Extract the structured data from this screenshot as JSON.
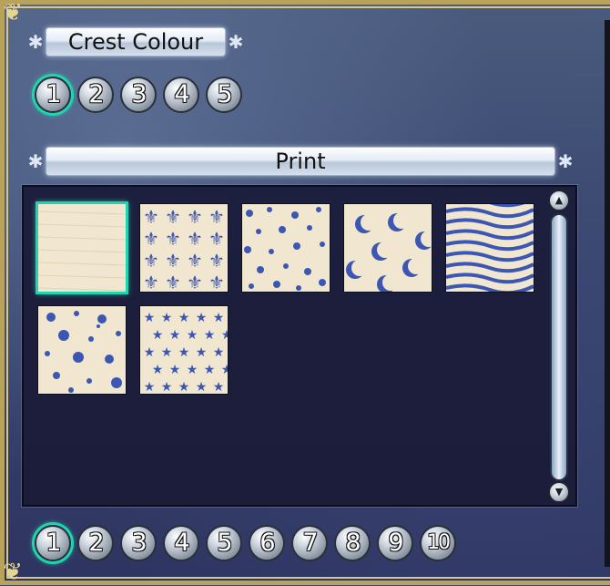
{
  "crest_colour": {
    "title": "Crest Colour",
    "options": [
      "1",
      "2",
      "3",
      "4",
      "5"
    ],
    "selected_index": 0
  },
  "print": {
    "title": "Print",
    "patterns": [
      {
        "name": "plain-pattern",
        "selected": true
      },
      {
        "name": "fleur-de-lis-pattern",
        "selected": false
      },
      {
        "name": "dots-pattern",
        "selected": false
      },
      {
        "name": "crescent-moon-pattern",
        "selected": false
      },
      {
        "name": "zebra-stripe-pattern",
        "selected": false
      },
      {
        "name": "large-polka-dot-pattern",
        "selected": false
      },
      {
        "name": "stars-pattern",
        "selected": false
      }
    ],
    "pattern_color": "#3b57b3",
    "tile_background": "#f1e6cf",
    "scroll_up_icon": "up-arrow-icon",
    "scroll_down_icon": "down-arrow-icon"
  },
  "pages": {
    "options": [
      "1",
      "2",
      "3",
      "4",
      "5",
      "6",
      "7",
      "8",
      "9",
      "10"
    ],
    "selected_index": 0
  },
  "colors": {
    "selection_glow": "#1fd4b0",
    "frame_gold": "#b9a25a"
  }
}
